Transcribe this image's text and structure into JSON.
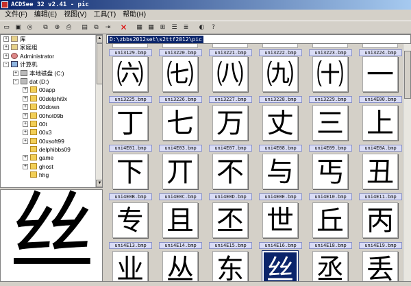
{
  "window": {
    "title": "ACDSee 32 v2.41 - pic"
  },
  "menu": [
    "文件(F)",
    "编辑(E)",
    "视图(V)",
    "工具(T)",
    "帮助(H)"
  ],
  "toolbar_icons": [
    "open-folder-icon",
    "save-icon",
    "find-icon",
    "copy-icon",
    "zoom-icon",
    "print-icon",
    "view-icon",
    "copy-to-icon",
    "move-to-icon",
    "delete-icon",
    "view-mode-icon",
    "thumbnails-icon",
    "tree-icon",
    "details-icon",
    "list-icon",
    "view-image-icon",
    "help-icon"
  ],
  "address": "D:\\zbbs2012set\\s2ttf2012\\pic",
  "tree": [
    {
      "label": "库",
      "icon": "library",
      "level": 0,
      "exp": "+"
    },
    {
      "label": "家庭组",
      "icon": "homegroup",
      "level": 0,
      "exp": "+"
    },
    {
      "label": "Administrator",
      "icon": "user",
      "level": 0,
      "exp": "+"
    },
    {
      "label": "计算机",
      "icon": "computer",
      "level": 0,
      "exp": "-"
    },
    {
      "label": "本地磁盘 (C:)",
      "icon": "drive",
      "level": 1,
      "exp": "+"
    },
    {
      "label": "dat (D:)",
      "icon": "drive",
      "level": 1,
      "exp": "-"
    },
    {
      "label": "00app",
      "icon": "folder",
      "level": 2,
      "exp": "+"
    },
    {
      "label": "00delphi9x",
      "icon": "folder",
      "level": 2,
      "exp": "+"
    },
    {
      "label": "00down",
      "icon": "folder",
      "level": 2,
      "exp": "+"
    },
    {
      "label": "00hot09b",
      "icon": "folder",
      "level": 2,
      "exp": "+"
    },
    {
      "label": "00t",
      "icon": "folder",
      "level": 2,
      "exp": "+"
    },
    {
      "label": "00x3",
      "icon": "folder",
      "level": 2,
      "exp": "+"
    },
    {
      "label": "00xsoft99",
      "icon": "folder",
      "level": 2,
      "exp": "+"
    },
    {
      "label": "delphibbs09",
      "icon": "folder",
      "level": 2,
      "exp": ""
    },
    {
      "label": "game",
      "icon": "folder",
      "level": 2,
      "exp": "+"
    },
    {
      "label": "ghost",
      "icon": "folder",
      "level": 2,
      "exp": "+"
    },
    {
      "label": "hhg",
      "icon": "folder",
      "level": 2,
      "exp": ""
    }
  ],
  "preview_char": "丝",
  "top_captions": [
    "uni3129.bmp",
    "uni3220.bmp",
    "uni3221.bmp",
    "uni3222.bmp",
    "uni3223.bmp",
    "uni3224.bmp"
  ],
  "thumbnails": [
    [
      {
        "caption": "uni3225.bmp",
        "char": "㈥"
      },
      {
        "caption": "uni3226.bmp",
        "char": "㈦"
      },
      {
        "caption": "uni3227.bmp",
        "char": "㈧"
      },
      {
        "caption": "uni3228.bmp",
        "char": "㈨"
      },
      {
        "caption": "uni3229.bmp",
        "char": "㈩"
      },
      {
        "caption": "uni4E00.bmp",
        "char": "一"
      }
    ],
    [
      {
        "caption": "uni4E01.bmp",
        "char": "丁"
      },
      {
        "caption": "uni4E03.bmp",
        "char": "七"
      },
      {
        "caption": "uni4E07.bmp",
        "char": "万"
      },
      {
        "caption": "uni4E08.bmp",
        "char": "丈"
      },
      {
        "caption": "uni4E09.bmp",
        "char": "三"
      },
      {
        "caption": "uni4E0A.bmp",
        "char": "上"
      }
    ],
    [
      {
        "caption": "uni4E0B.bmp",
        "char": "下"
      },
      {
        "caption": "uni4E0C.bmp",
        "char": "丌"
      },
      {
        "caption": "uni4E0D.bmp",
        "char": "不"
      },
      {
        "caption": "uni4E0E.bmp",
        "char": "与"
      },
      {
        "caption": "uni4E10.bmp",
        "char": "丐"
      },
      {
        "caption": "uni4E11.bmp",
        "char": "丑"
      }
    ],
    [
      {
        "caption": "uni4E13.bmp",
        "char": "专"
      },
      {
        "caption": "uni4E14.bmp",
        "char": "且"
      },
      {
        "caption": "uni4E15.bmp",
        "char": "丕"
      },
      {
        "caption": "uni4E16.bmp",
        "char": "世"
      },
      {
        "caption": "uni4E18.bmp",
        "char": "丘"
      },
      {
        "caption": "uni4E19.bmp",
        "char": "丙"
      }
    ],
    [
      {
        "caption": "",
        "char": "业"
      },
      {
        "caption": "",
        "char": "丛"
      },
      {
        "caption": "",
        "char": "东"
      },
      {
        "caption": "",
        "char": "丝",
        "selected": true
      },
      {
        "caption": "",
        "char": "丞"
      },
      {
        "caption": "",
        "char": "丢"
      }
    ]
  ]
}
